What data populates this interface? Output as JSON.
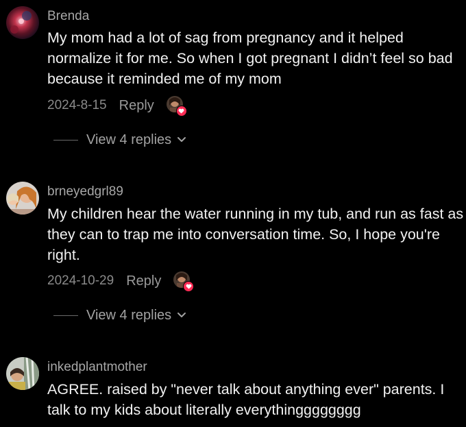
{
  "comments": [
    {
      "username": "Brenda",
      "text": "My mom had a lot of sag from pregnancy and it helped normalize it for me. So when I got pregnant I didn’t feel so bad because it reminded me of my mom",
      "date": "2024-8-15",
      "reply_label": "Reply",
      "view_replies_label": "View 4 replies"
    },
    {
      "username": "brneyedgrl89",
      "text": "My children hear the water running in my tub, and run as fast as they can to trap me into conversation time. So, I hope you're right.",
      "date": "2024-10-29",
      "reply_label": "Reply",
      "view_replies_label": "View 4 replies"
    },
    {
      "username": "inkedplantmother",
      "text": "AGREE. raised by \"never talk about anything ever\" parents. I talk to my kids about literally everythingggggggg"
    }
  ],
  "colors": {
    "background": "#000000",
    "text": "#f2f2f2",
    "username": "#a8a8a8",
    "meta": "#8a8a8a",
    "like_badge": "#fe2c55"
  },
  "icons": {
    "chevron": "chevron-down-icon",
    "heart": "heart-icon"
  }
}
